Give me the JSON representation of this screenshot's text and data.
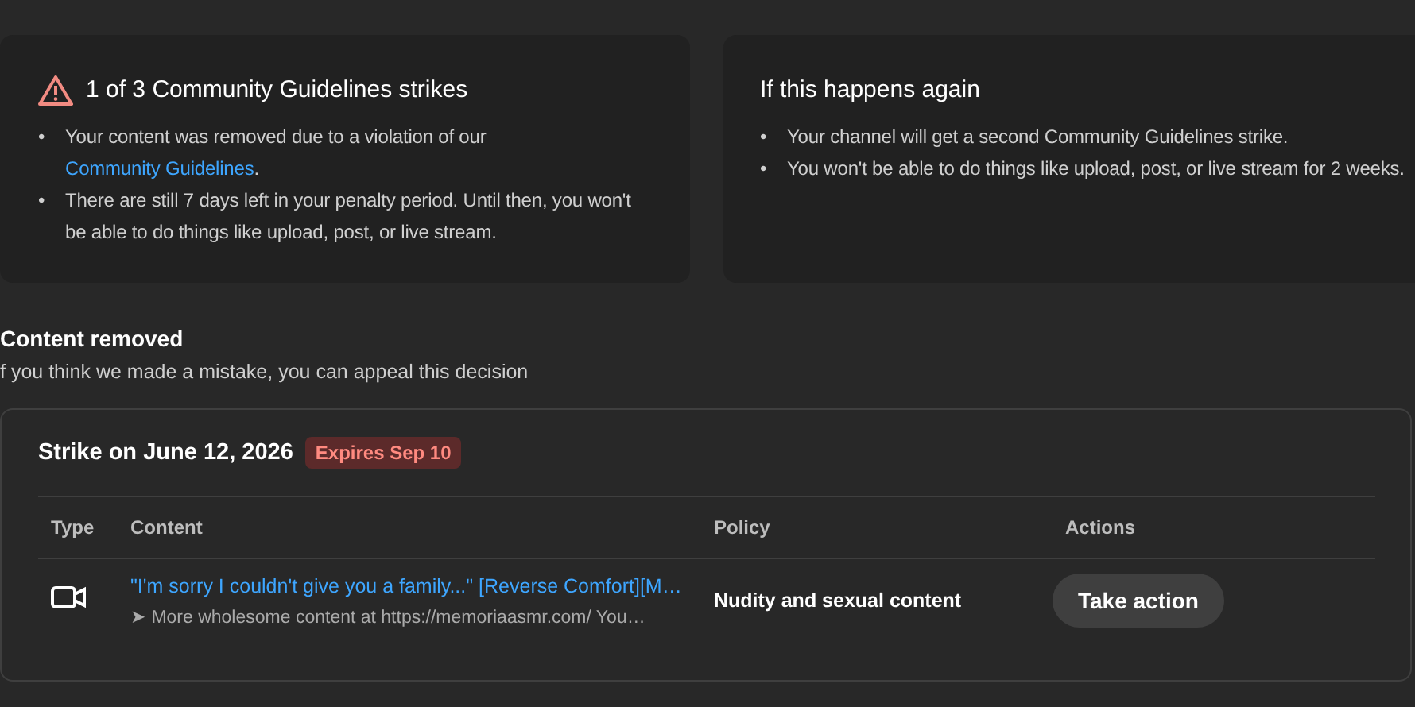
{
  "strike_card": {
    "title": "1 of 3 Community Guidelines strikes",
    "bullets": [
      {
        "marker": "•",
        "text": "Your content was removed due to a violation of our ",
        "link": "Community Guidelines",
        "after": "."
      },
      {
        "marker": "•",
        "text": "There are still 7 days left in your penalty period. Until then, you won't be able to do things like upload, post, or live stream."
      }
    ]
  },
  "next_card": {
    "title": "If this happens again",
    "bullets": [
      {
        "marker": "•",
        "text": "Your channel will get a second Community Guidelines strike."
      },
      {
        "marker": "•",
        "text": "You won't be able to do things like upload, post, or live stream for 2 weeks."
      }
    ]
  },
  "section": {
    "title": "Content removed",
    "subtitle": "f you think we made a mistake, you can appeal this decision"
  },
  "strike": {
    "title": "Strike on June 12, 2026",
    "badge": "Expires Sep 10",
    "table": {
      "columns": [
        "Type",
        "Content",
        "Policy",
        "Actions"
      ],
      "rows": [
        {
          "kind": "video",
          "title": "\"I'm sorry I couldn't give you a family...\" [Reverse Comfort][M…",
          "description": "➤ More wholesome content at https://memoriaasmr.com/ You…",
          "policy": "Nudity and sexual content",
          "action": "Take action"
        }
      ]
    }
  }
}
